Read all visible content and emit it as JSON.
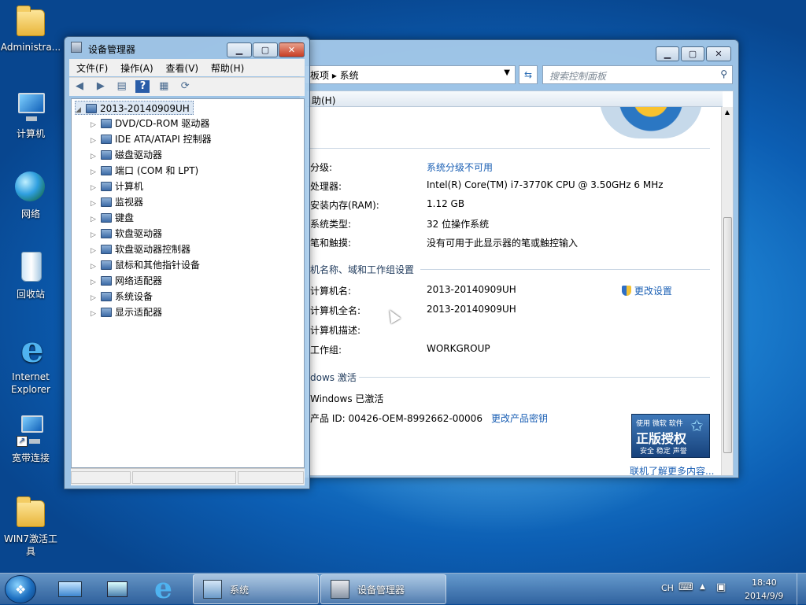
{
  "desktop": {
    "icons": [
      {
        "label": "Administra..."
      },
      {
        "label": "计算机"
      },
      {
        "label": "网络"
      },
      {
        "label": "回收站"
      },
      {
        "label": "Internet Explorer"
      },
      {
        "label": "宽带连接"
      },
      {
        "label": "WIN7激活工具"
      }
    ]
  },
  "system_window": {
    "breadcrumb": "板项  ▸  系统",
    "search_placeholder": "搜索控制面板",
    "menu_help": "助(H)",
    "rows": [
      {
        "label": "分级:",
        "value": "系统分级不可用",
        "link": true
      },
      {
        "label": "处理器:",
        "value": "Intel(R) Core(TM) i7-3770K CPU @ 3.50GHz   6 MHz",
        "link": false
      },
      {
        "label": "安装内存(RAM):",
        "value": "1.12 GB",
        "link": false
      },
      {
        "label": "系统类型:",
        "value": "32 位操作系统",
        "link": false
      },
      {
        "label": "笔和触摸:",
        "value": "没有可用于此显示器的笔或触控输入",
        "link": false
      }
    ],
    "section_computer": "机名称、域和工作组设置",
    "computer_rows": [
      {
        "label": "计算机名:",
        "value": "2013-20140909UH"
      },
      {
        "label": "计算机全名:",
        "value": "2013-20140909UH"
      },
      {
        "label": "计算机描述:",
        "value": ""
      },
      {
        "label": "工作组:",
        "value": "WORKGROUP"
      }
    ],
    "change_settings": "更改设置",
    "section_windows": "dows 激活",
    "activation_status": "Windows 已激活",
    "product_id": "产品 ID: 00426-OEM-8992662-00006",
    "change_key": "更改产品密钥",
    "badge_top": "使用 微软 软件",
    "badge_main": "正版授权",
    "badge_sub": "安全 稳定 声誉",
    "learn_more": "联机了解更多内容..."
  },
  "device_manager": {
    "title": "设备管理器",
    "menu": [
      "文件(F)",
      "操作(A)",
      "查看(V)",
      "帮助(H)"
    ],
    "root": "2013-20140909UH",
    "devices": [
      "DVD/CD-ROM 驱动器",
      "IDE ATA/ATAPI 控制器",
      "磁盘驱动器",
      "端口 (COM 和 LPT)",
      "计算机",
      "监视器",
      "键盘",
      "软盘驱动器",
      "软盘驱动器控制器",
      "鼠标和其他指针设备",
      "网络适配器",
      "系统设备",
      "显示适配器"
    ]
  },
  "taskbar": {
    "tasks": [
      "系统",
      "设备管理器"
    ],
    "lang": "CH",
    "time": "18:40",
    "date": "2014/9/9"
  },
  "colors": {
    "link": "#1a5fb4",
    "taskbar": "#3c69a0"
  }
}
